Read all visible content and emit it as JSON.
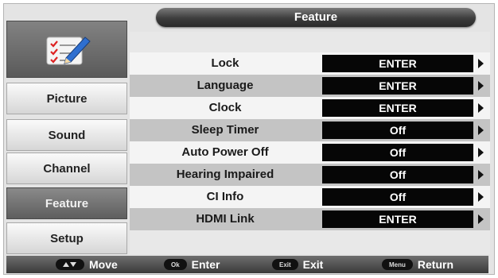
{
  "title": "Feature",
  "menu": {
    "items": [
      {
        "label": "Picture"
      },
      {
        "label": "Sound"
      },
      {
        "label": "Channel"
      },
      {
        "label": "Feature"
      },
      {
        "label": "Setup"
      }
    ],
    "active": "Feature"
  },
  "settings": [
    {
      "label": "Lock",
      "value": "ENTER"
    },
    {
      "label": "Language",
      "value": "ENTER"
    },
    {
      "label": "Clock",
      "value": "ENTER"
    },
    {
      "label": "Sleep Timer",
      "value": "Off"
    },
    {
      "label": "Auto Power Off",
      "value": "Off"
    },
    {
      "label": "Hearing Impaired",
      "value": "Off"
    },
    {
      "label": "CI Info",
      "value": "Off"
    },
    {
      "label": "HDMI Link",
      "value": "ENTER"
    }
  ],
  "footer": {
    "move": {
      "key": "",
      "label": "Move"
    },
    "enter": {
      "key": "Ok",
      "label": "Enter"
    },
    "exit": {
      "key": "Exit",
      "label": "Exit"
    },
    "return": {
      "key": "Menu",
      "label": "Return"
    }
  },
  "colors": {
    "value_box": "#060606",
    "active_menu": "#6a6a6a",
    "title_bar": "#3c3c3c"
  },
  "icons": {
    "menu_icon": "checklist-pencil-icon",
    "row_arrow": "triangle-right-icon",
    "move_key": "up-down-arrows-icon"
  }
}
